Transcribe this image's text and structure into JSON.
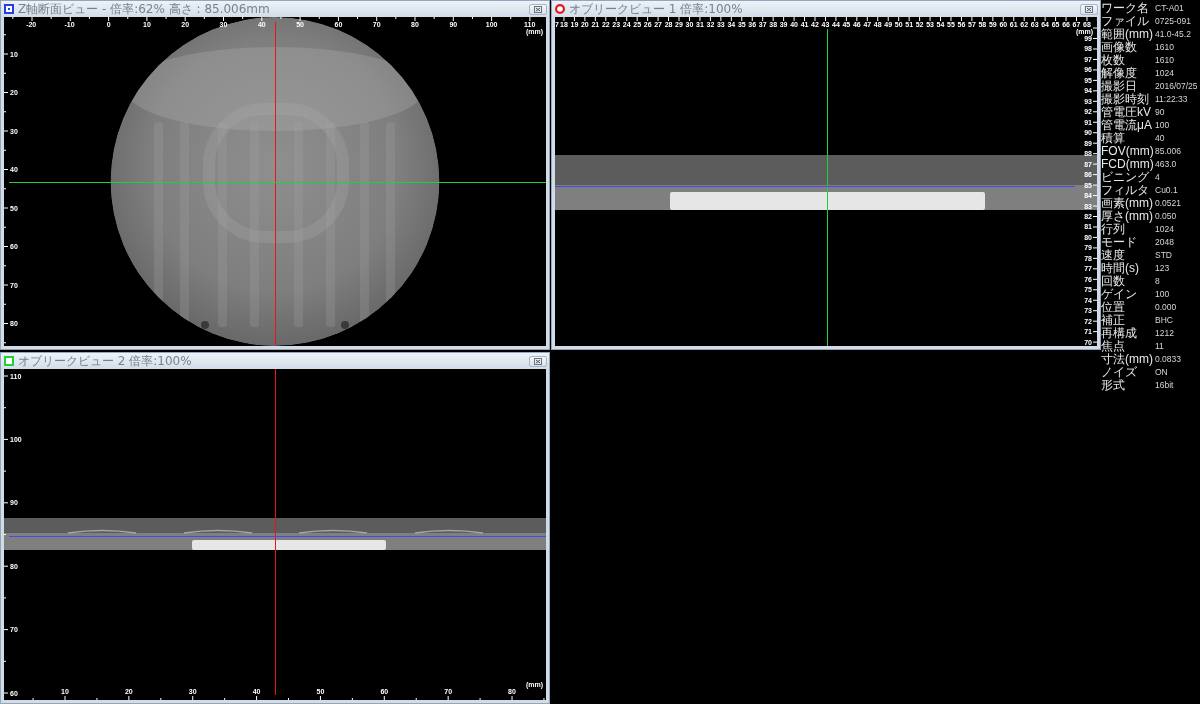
{
  "views": [
    {
      "kind": "axial",
      "title": "Z軸断面ビュー - 倍率:62% 高さ : 85.006mm",
      "marker": {
        "kind": "boxed-square",
        "color": "#2440e0"
      },
      "unit": "(mm)",
      "x_ruler": {
        "labels": [
          "-20",
          "-10",
          "0",
          "10",
          "20",
          "30",
          "40",
          "50",
          "60",
          "70",
          "80",
          "90",
          "100",
          "110"
        ]
      },
      "y_ruler": {
        "labels": [
          "10",
          "20",
          "30",
          "40",
          "50",
          "60",
          "70",
          "80"
        ]
      },
      "crosshairs": [
        {
          "kind": "vertical",
          "color": "#e8141e"
        },
        {
          "kind": "horizontal",
          "color": "#22d03a"
        }
      ]
    },
    {
      "kind": "oblique",
      "title": "オブリークビュー 1 倍率:100%",
      "marker": {
        "kind": "circle",
        "color": "#e8141e"
      },
      "unit": "(mm)",
      "x_ruler": {
        "labels": [
          "7",
          "18",
          "19",
          "20",
          "21",
          "22",
          "23",
          "24",
          "25",
          "26",
          "27",
          "28",
          "29",
          "30",
          "31",
          "32",
          "33",
          "34",
          "35",
          "36",
          "37",
          "38",
          "39",
          "40",
          "41",
          "42",
          "43",
          "44",
          "45",
          "46",
          "47",
          "48",
          "49",
          "50",
          "51",
          "52",
          "53",
          "54",
          "55",
          "56",
          "57",
          "58",
          "59",
          "60",
          "61",
          "62",
          "63",
          "64",
          "65",
          "66",
          "67",
          "68"
        ]
      },
      "y_ruler": {
        "labels": [
          "99",
          "98",
          "97",
          "96",
          "95",
          "94",
          "93",
          "92",
          "91",
          "90",
          "89",
          "88",
          "87",
          "86",
          "85",
          "84",
          "83",
          "82",
          "81",
          "80",
          "79",
          "78",
          "77",
          "76",
          "75",
          "74",
          "73",
          "72",
          "71",
          "70"
        ]
      },
      "crosshairs": [
        {
          "kind": "vertical",
          "color": "#22d03a"
        },
        {
          "kind": "horizontal",
          "color": "#4848e8"
        }
      ]
    },
    {
      "kind": "oblique",
      "title": "オブリークビュー 2 倍率:100%",
      "marker": {
        "kind": "square",
        "color": "#22d03a"
      },
      "unit": "(mm)",
      "x_ruler": {
        "labels": [
          "10",
          "20",
          "30",
          "40",
          "50",
          "60",
          "70",
          "80"
        ]
      },
      "y_ruler": {
        "labels": [
          "110",
          "100",
          "90",
          "80",
          "70",
          "60"
        ]
      },
      "crosshairs": [
        {
          "kind": "vertical",
          "color": "#e8141e"
        },
        {
          "kind": "horizontal",
          "color": "#4848e8"
        }
      ]
    }
  ],
  "info_panel": {
    "rows": [
      {
        "label": "ワーク名",
        "value": "CT-A01"
      },
      {
        "label": "ファイル",
        "value": "0725-091"
      },
      {
        "label": "範囲(mm)",
        "value": "41.0-45.2"
      },
      {
        "label": "画像数",
        "value": "1610"
      },
      {
        "label": "枚数",
        "value": "1610"
      },
      {
        "label": "解像度",
        "value": "1024"
      },
      {
        "label": "撮影日",
        "value": "2016/07/25"
      },
      {
        "label": "撮影時刻",
        "value": "11:22:33"
      },
      {
        "label": "管電圧kV",
        "value": "90"
      },
      {
        "label": "管電流μA",
        "value": "100"
      },
      {
        "label": "積算",
        "value": "40"
      },
      {
        "label": "FOV(mm)",
        "value": "85.006"
      },
      {
        "label": "FCD(mm)",
        "value": "463.0"
      },
      {
        "label": "ビニング",
        "value": "4"
      },
      {
        "label": "フィルタ",
        "value": "Cu0.1"
      },
      {
        "label": "画素(mm)",
        "value": "0.0521"
      },
      {
        "label": "厚さ(mm)",
        "value": "0.050"
      },
      {
        "label": "行列",
        "value": "1024"
      },
      {
        "label": "モード",
        "value": "2048"
      },
      {
        "label": "速度",
        "value": "STD"
      },
      {
        "label": "時間(s)",
        "value": "123"
      },
      {
        "label": "回数",
        "value": "8"
      },
      {
        "label": "ゲイン",
        "value": "100"
      },
      {
        "label": "位置",
        "value": "0.000"
      },
      {
        "label": "補正",
        "value": "BHC"
      },
      {
        "label": "再構成",
        "value": "1212"
      },
      {
        "label": "焦点",
        "value": "11"
      },
      {
        "label": "寸法(mm)",
        "value": "0.0833"
      },
      {
        "label": "ノイズ",
        "value": "ON"
      },
      {
        "label": "形式",
        "value": "16bit"
      }
    ]
  }
}
